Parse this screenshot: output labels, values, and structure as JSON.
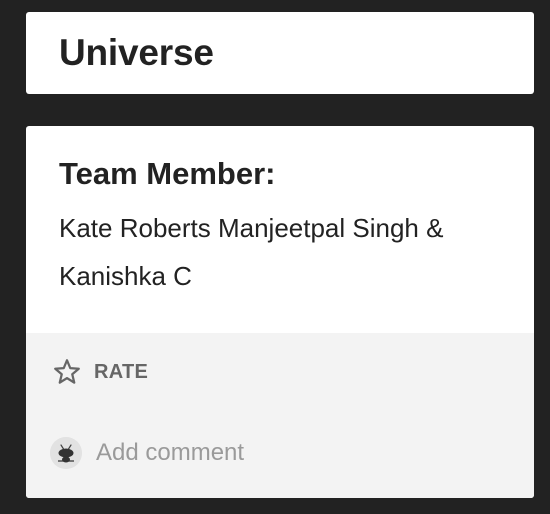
{
  "title_card": {
    "title": "Universe"
  },
  "member_card": {
    "heading": "Team Member:",
    "names": "Kate Roberts Manjeetpal Singh & Kanishka C"
  },
  "footer": {
    "rate_label": "RATE",
    "star_icon": "star-outline-icon",
    "avatar_icon": "ant-avatar-icon",
    "comment_placeholder": "Add comment"
  },
  "colors": {
    "page_background": "#222222",
    "card_background": "#ffffff",
    "footer_background": "#f3f3f3",
    "text_primary": "#222222",
    "text_secondary": "#666666",
    "placeholder_text": "#9a9a9a"
  }
}
